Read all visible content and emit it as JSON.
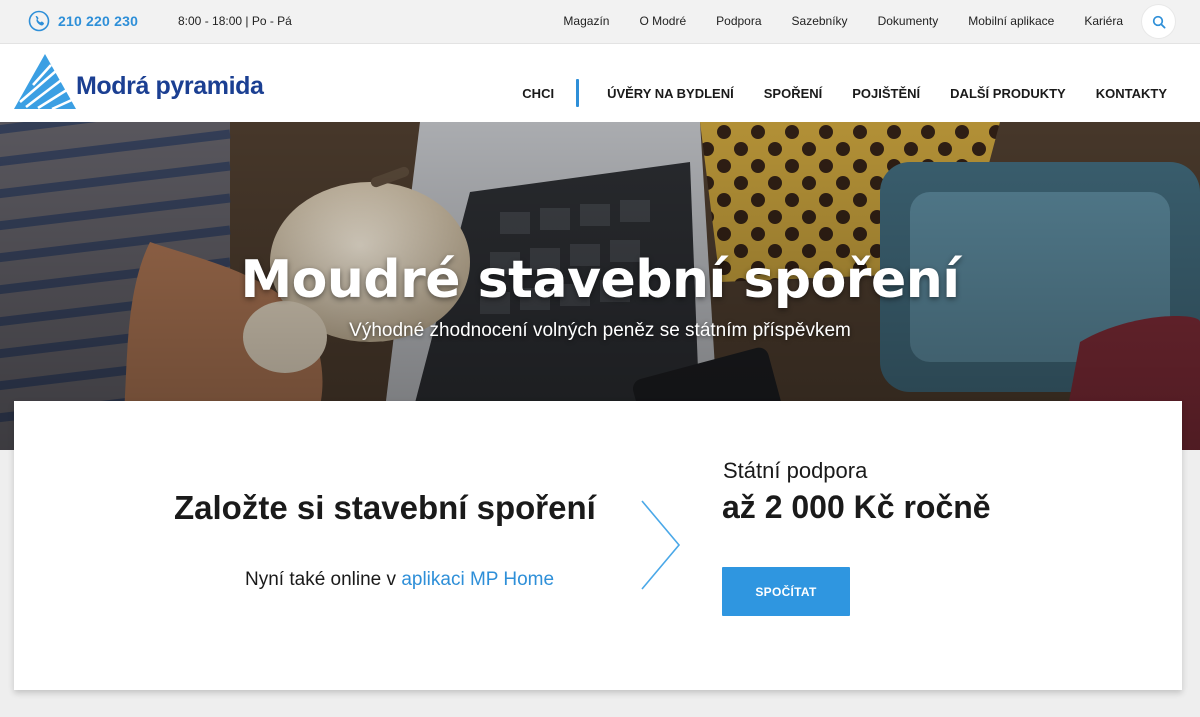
{
  "topbar": {
    "phone": "210 220 230",
    "hours": "8:00 - 18:00 | Po - Pá",
    "links": [
      "Magazín",
      "O Modré",
      "Podpora",
      "Sazebníky",
      "Dokumenty",
      "Mobilní aplikace",
      "Kariéra"
    ],
    "search_icon": "search-icon"
  },
  "header": {
    "logo_text": "Modrá pyramida",
    "nav": [
      "CHCI",
      "ÚVĚRY NA BYDLENÍ",
      "SPOŘENÍ",
      "POJIŠTĚNÍ",
      "DALŠÍ PRODUKTY",
      "KONTAKTY"
    ]
  },
  "hero": {
    "title": "Moudré stavební spoření",
    "subtitle": "Výhodné zhodnocení volných peněz se státním příspěvkem"
  },
  "card": {
    "heading": "Založte si stavební spoření",
    "online_prefix": "Nyní také online v ",
    "online_link": "aplikaci MP Home",
    "support_label": "Státní podpora",
    "support_amount": "až 2 000 Kč ročně",
    "button_label": "SPOČÍTAT"
  },
  "colors": {
    "accent": "#2e8fd8",
    "brand": "#1b3f92",
    "button": "#2f96e0"
  }
}
